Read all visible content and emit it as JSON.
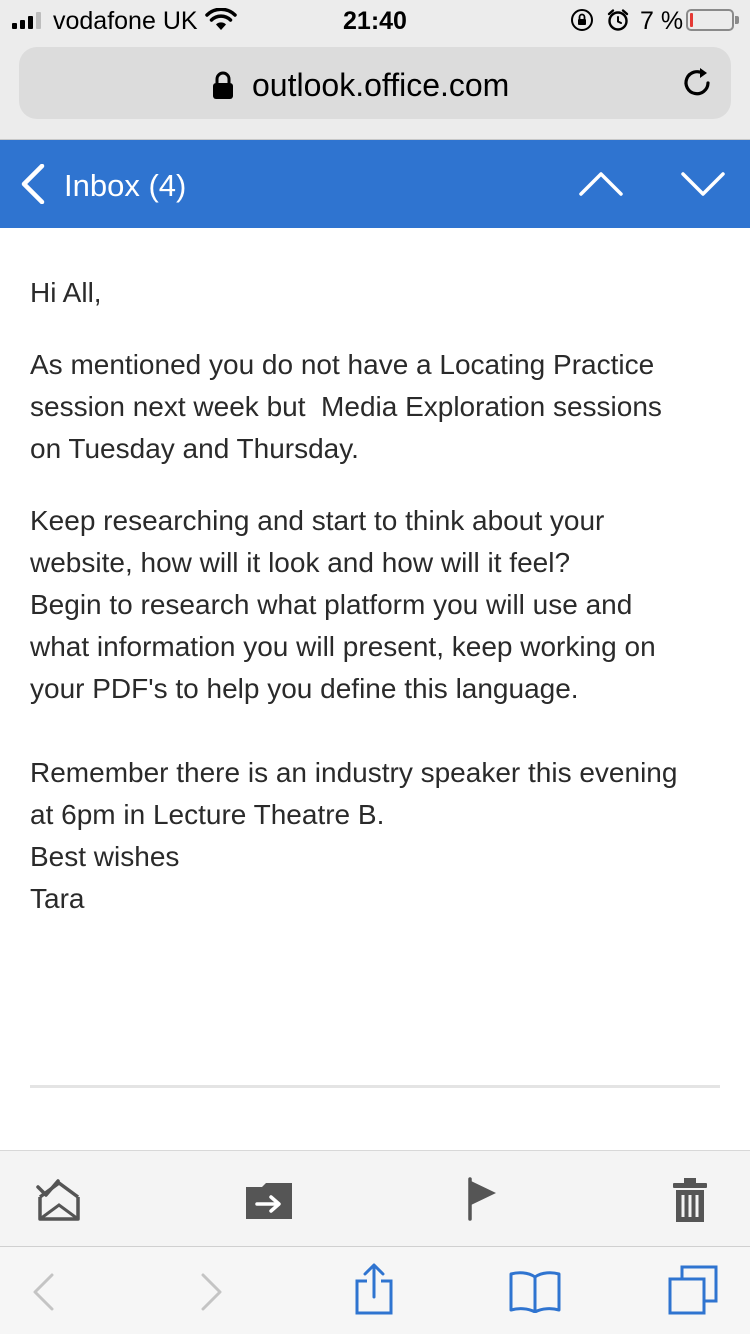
{
  "status_bar": {
    "carrier": "vodafone UK",
    "time": "21:40",
    "battery_percent_text": "7 %",
    "battery_level": 0.07,
    "signal_bars_filled": 3,
    "signal_bars_total": 4
  },
  "browser": {
    "url": "outlook.office.com"
  },
  "header": {
    "back_label": "Inbox (4)",
    "color": "#2f74d0"
  },
  "email": {
    "greeting": "Hi All,",
    "paragraph_1_lines": [
      "As mentioned you do not have a Locating Practice",
      "session next week but  Media Exploration sessions",
      "on Tuesday and Thursday."
    ],
    "paragraph_2_lines": [
      "Keep researching and start to think about your",
      "website, how will it look and how will it feel?",
      "Begin to research what platform you will use and",
      "what information you will present, keep working on",
      "your PDF's to help you define this language."
    ],
    "paragraph_3_lines": [
      "Remember there is an industry speaker this evening",
      "at 6pm in Lecture Theatre B.",
      "Best wishes",
      "Tara"
    ]
  },
  "mail_toolbar": {
    "icons": [
      "mark-read-icon",
      "move-to-folder-icon",
      "flag-icon",
      "delete-icon"
    ]
  },
  "safari_toolbar": {
    "icons": [
      "back-icon",
      "forward-icon",
      "share-icon",
      "bookmarks-icon",
      "tabs-icon"
    ],
    "accent": "#2f74d0"
  }
}
